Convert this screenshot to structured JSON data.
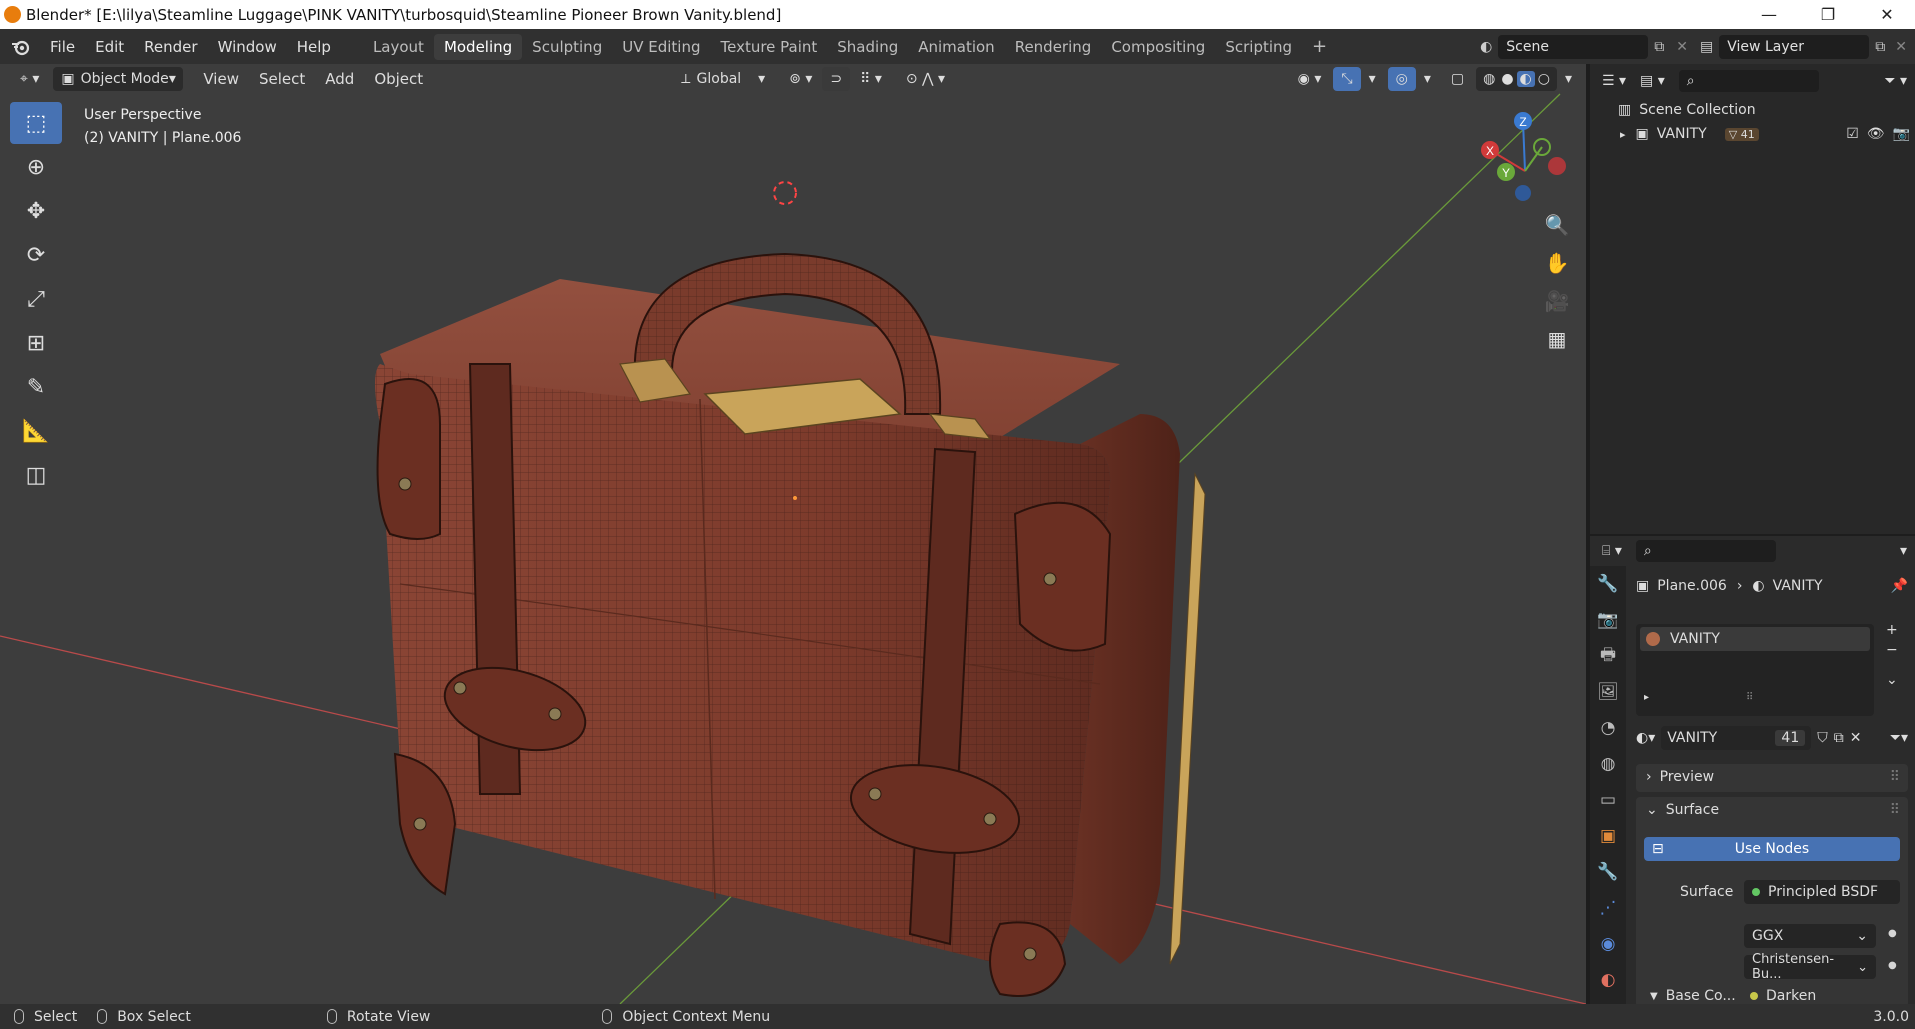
{
  "window": {
    "title": "Blender* [E:\\lilya\\Steamline Luggage\\PINK VANITY\\turbosquid\\Steamline Pioneer Brown Vanity.blend]",
    "minimize": "—",
    "restore": "❐",
    "close": "✕"
  },
  "menu": [
    "File",
    "Edit",
    "Render",
    "Window",
    "Help"
  ],
  "workspaces": [
    {
      "label": "Layout",
      "active": false
    },
    {
      "label": "Modeling",
      "active": true
    },
    {
      "label": "Sculpting",
      "active": false
    },
    {
      "label": "UV Editing",
      "active": false
    },
    {
      "label": "Texture Paint",
      "active": false
    },
    {
      "label": "Shading",
      "active": false
    },
    {
      "label": "Animation",
      "active": false
    },
    {
      "label": "Rendering",
      "active": false
    },
    {
      "label": "Compositing",
      "active": false
    },
    {
      "label": "Scripting",
      "active": false
    }
  ],
  "add_workspace": "+",
  "scene": {
    "label": "Scene"
  },
  "view_layer": {
    "label": "View Layer"
  },
  "viewport": {
    "mode": "Object Mode",
    "menus": [
      "View",
      "Select",
      "Add",
      "Object"
    ],
    "orientation": "Global",
    "perspective": "User Perspective",
    "object_info": "(2) VANITY | Plane.006",
    "axis_labels": {
      "x": "X",
      "y": "Y",
      "z": "Z"
    }
  },
  "outliner": {
    "scene_collection": "Scene Collection",
    "item": "VANITY",
    "item_count": "41"
  },
  "properties": {
    "object": "Plane.006",
    "material": "VANITY",
    "slot": "VANITY",
    "material_name": "VANITY",
    "users": "41",
    "panels": {
      "preview": "Preview",
      "surface": "Surface"
    },
    "use_nodes": "Use Nodes",
    "surface_label": "Surface",
    "surface_value": "Principled BSDF",
    "distribution": "GGX",
    "subsurface": "Christensen-Bu...",
    "base_color_label": "Base Co...",
    "base_color_value": "Darken"
  },
  "statusbar": {
    "select": "Select",
    "box_select": "Box Select",
    "rotate": "Rotate View",
    "context": "Object Context Menu",
    "version": "3.0.0"
  },
  "colors": {
    "accent": "#4772b3",
    "viewport_bg": "#3d3d3d",
    "suitcase": "#7a3a2a",
    "brass": "#c9a45a",
    "x_axis": "#d13a3a",
    "y_axis": "#6aa83a",
    "z_axis": "#3a7ad1"
  }
}
